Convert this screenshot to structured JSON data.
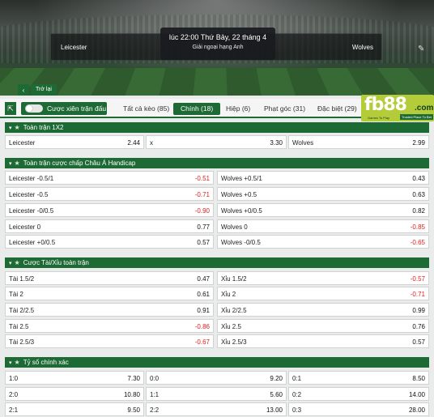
{
  "match": {
    "home": "Leicester",
    "away": "Wolves",
    "time": "lúc 22:00 Thứ Bảy, 22 tháng 4",
    "league": "Giải ngoại hạng Anh",
    "back_label": "Trở lại"
  },
  "tabs": {
    "combo_label": "Cược xiên trận đấu",
    "items": [
      "Tất cả kèo (85)",
      "Chính (18)",
      "Hiệp (6)",
      "Phạt góc (31)",
      "Đặc biệt (29)"
    ],
    "active_index": 1
  },
  "logo": {
    "fb": "fb",
    "num": "88",
    "com": ".com",
    "tag1": "Games To Play",
    "tag2": "Trusted Place To Bet"
  },
  "sections": {
    "one_x_two": {
      "title": "Toàn trận 1X2",
      "cells": [
        {
          "name": "Leicester",
          "odd": "2.44"
        },
        {
          "name": "x",
          "odd": "3.30"
        },
        {
          "name": "Wolves",
          "odd": "2.99"
        }
      ]
    },
    "handicap": {
      "title": "Toàn trận cược chấp Châu Á Handicap",
      "rows": [
        [
          {
            "name": "Leicester -0.5/1",
            "odd": "-0.51"
          },
          {
            "name": "Wolves +0.5/1",
            "odd": "0.43"
          }
        ],
        [
          {
            "name": "Leicester -0.5",
            "odd": "-0.71"
          },
          {
            "name": "Wolves +0.5",
            "odd": "0.63"
          }
        ],
        [
          {
            "name": "Leicester -0/0.5",
            "odd": "-0.90"
          },
          {
            "name": "Wolves +0/0.5",
            "odd": "0.82"
          }
        ],
        [
          {
            "name": "Leicester 0",
            "odd": "0.77"
          },
          {
            "name": "Wolves 0",
            "odd": "-0.85"
          }
        ],
        [
          {
            "name": "Leicester +0/0.5",
            "odd": "0.57"
          },
          {
            "name": "Wolves -0/0.5",
            "odd": "-0.65"
          }
        ]
      ]
    },
    "over_under": {
      "title": "Cược Tài/Xỉu toàn trận",
      "rows": [
        [
          {
            "name": "Tài 1.5/2",
            "odd": "0.47"
          },
          {
            "name": "Xỉu 1.5/2",
            "odd": "-0.57"
          }
        ],
        [
          {
            "name": "Tài 2",
            "odd": "0.61"
          },
          {
            "name": "Xỉu 2",
            "odd": "-0.71"
          }
        ],
        [
          {
            "name": "Tài 2/2.5",
            "odd": "0.91"
          },
          {
            "name": "Xỉu 2/2.5",
            "odd": "0.99"
          }
        ],
        [
          {
            "name": "Tài 2.5",
            "odd": "-0.86"
          },
          {
            "name": "Xỉu 2.5",
            "odd": "0.76"
          }
        ],
        [
          {
            "name": "Tài 2.5/3",
            "odd": "-0.67"
          },
          {
            "name": "Xỉu 2.5/3",
            "odd": "0.57"
          }
        ]
      ]
    },
    "correct_score": {
      "title": "Tỷ số chính xác",
      "rows": [
        [
          {
            "name": "1:0",
            "odd": "7.30"
          },
          {
            "name": "0:0",
            "odd": "9.20"
          },
          {
            "name": "0:1",
            "odd": "8.50"
          }
        ],
        [
          {
            "name": "2:0",
            "odd": "10.80"
          },
          {
            "name": "1:1",
            "odd": "5.60"
          },
          {
            "name": "0:2",
            "odd": "14.00"
          }
        ],
        [
          {
            "name": "2:1",
            "odd": "9.50"
          },
          {
            "name": "2:2",
            "odd": "13.00"
          },
          {
            "name": "0:3",
            "odd": "28.00"
          }
        ]
      ]
    }
  },
  "colors": {
    "brand_green": "#1d6a34",
    "negative_red": "#e02020",
    "logo_lime": "#b5cc3a"
  },
  "icons": {
    "back": "chevron-left-icon",
    "expand": "expand-collapse-icon",
    "section": "chevron-down-icon",
    "favorite": "star-icon",
    "pin": "pin-icon"
  }
}
